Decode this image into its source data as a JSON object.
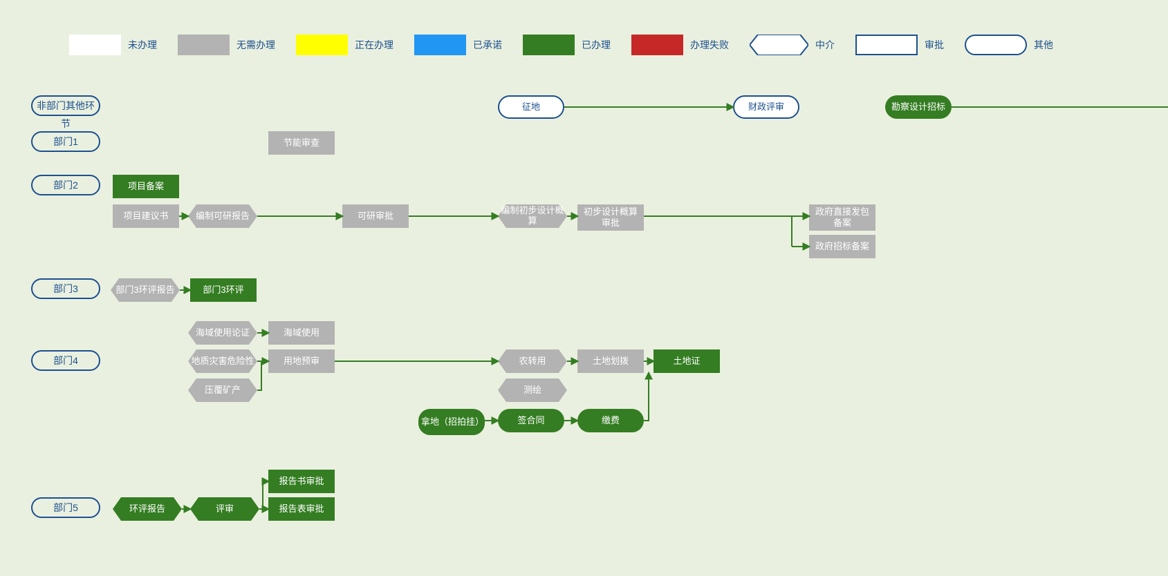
{
  "legend": {
    "not_processed": "未办理",
    "no_need": "无需办理",
    "processing": "正在办理",
    "promised": "已承诺",
    "done": "已办理",
    "failed": "办理失败",
    "intermediary": "中介",
    "approval": "审批",
    "other": "其他"
  },
  "colors": {
    "not_processed": "#ffffff",
    "no_need": "#b3b3b3",
    "processing": "#ffff00",
    "promised": "#2196f3",
    "done": "#347d22",
    "failed": "#c62828",
    "intermediary_border": "#1b4f8f",
    "approval_border": "#1b4f8f",
    "other_border": "#1b4f8f"
  },
  "dept_labels": {
    "non_dept": "非部门其他环节",
    "dept1": "部门1",
    "dept2": "部门2",
    "dept3": "部门3",
    "dept4": "部门4",
    "dept5": "部门5"
  },
  "nodes": {
    "land_acq": "征地",
    "financial_review": "财政评审",
    "survey_bid": "勘察设计招标",
    "energy_review": "节能审查",
    "project_filing": "项目备案",
    "project_proposal": "项目建议书",
    "feasibility_report": "编制可研报告",
    "feasibility_approval": "可研审批",
    "preliminary_budget": "编制初步设计概算",
    "preliminary_approval": "初步设计概算审批",
    "gov_direct_filing": "政府直接发包备案",
    "gov_bid_filing": "政府招标备案",
    "dept3_env_report": "部门3环评报告",
    "dept3_env": "部门3环评",
    "sea_use_demo": "海域使用论证",
    "sea_use": "海域使用",
    "geo_hazard": "地质灾害危险性",
    "land_preapproval": "用地预审",
    "mining": "压覆矿产",
    "land_conversion": "农转用",
    "survey_map": "测绘",
    "land_allocation": "土地划拨",
    "land_cert": "土地证",
    "land_auction": "拿地（招拍挂）",
    "sign_contract": "签合同",
    "pay_fee": "缴费",
    "env_report": "环评报告",
    "review": "评审",
    "report_book_approval": "报告书审批",
    "report_form_approval": "报告表审批"
  }
}
